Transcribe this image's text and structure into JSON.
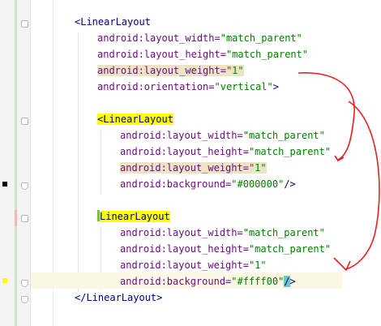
{
  "editor": {
    "lines": [
      {
        "indent": 92,
        "parts": [
          {
            "cls": "tag",
            "text": "<LinearLayout"
          }
        ]
      },
      {
        "indent": 120,
        "parts": [
          {
            "cls": "attr",
            "text": "android:layout_width="
          },
          {
            "cls": "val",
            "text": "\"match_parent\""
          }
        ]
      },
      {
        "indent": 120,
        "parts": [
          {
            "cls": "attr",
            "text": "android:layout_height="
          },
          {
            "cls": "val",
            "text": "\"match_parent\""
          }
        ]
      },
      {
        "indent": 120,
        "parts": [
          {
            "cls": "attr hl-attr",
            "text": "android:layout_weight="
          },
          {
            "cls": "val hl-attr",
            "text": "\"1\""
          }
        ]
      },
      {
        "indent": 120,
        "parts": [
          {
            "cls": "attr",
            "text": "android:orientation="
          },
          {
            "cls": "val",
            "text": "\"vertical\""
          },
          {
            "cls": "tag",
            "text": ">"
          }
        ]
      },
      {
        "indent": 120,
        "parts": []
      },
      {
        "indent": 120,
        "parts": [
          {
            "cls": "tag hl-tag",
            "text": "<LinearLayout"
          }
        ]
      },
      {
        "indent": 148,
        "parts": [
          {
            "cls": "attr",
            "text": "android:layout_width="
          },
          {
            "cls": "val",
            "text": "\"match_parent\""
          }
        ]
      },
      {
        "indent": 148,
        "parts": [
          {
            "cls": "attr",
            "text": "android:layout_height="
          },
          {
            "cls": "val",
            "text": "\"match_parent\""
          }
        ]
      },
      {
        "indent": 148,
        "parts": [
          {
            "cls": "attr hl-attr",
            "text": "android:layout_weight="
          },
          {
            "cls": "val hl-attr",
            "text": "\"1\""
          }
        ]
      },
      {
        "indent": 148,
        "parts": [
          {
            "cls": "attr",
            "text": "android:background="
          },
          {
            "cls": "val",
            "text": "\"#000000\""
          },
          {
            "cls": "tag",
            "text": "/>"
          }
        ]
      },
      {
        "indent": 120,
        "parts": []
      },
      {
        "indent": 120,
        "parts": [
          {
            "cls": "caret-mark",
            "text": ""
          },
          {
            "cls": "tag hl-tag",
            "text": "LinearLayout"
          }
        ]
      },
      {
        "indent": 148,
        "parts": [
          {
            "cls": "attr",
            "text": "android:layout_width="
          },
          {
            "cls": "val",
            "text": "\"match_parent\""
          }
        ]
      },
      {
        "indent": 148,
        "parts": [
          {
            "cls": "attr",
            "text": "android:layout_height="
          },
          {
            "cls": "val",
            "text": "\"match_parent\""
          }
        ]
      },
      {
        "indent": 148,
        "parts": [
          {
            "cls": "attr",
            "text": "android:layout_weight="
          },
          {
            "cls": "val",
            "text": "\"1\""
          }
        ]
      },
      {
        "indent": 148,
        "parts": [
          {
            "cls": "attr",
            "text": "android:background="
          },
          {
            "cls": "val",
            "text": "\"#ffff00\""
          },
          {
            "cls": "tag hl-close",
            "text": "/"
          },
          {
            "cls": "tag",
            "text": ">"
          }
        ]
      },
      {
        "indent": 92,
        "parts": [
          {
            "cls": "tag",
            "text": "</LinearLayout>"
          }
        ]
      }
    ]
  },
  "annotation_color": "#e82020",
  "marker_colors": {
    "black": "#000000",
    "yellow": "#ffff00"
  }
}
